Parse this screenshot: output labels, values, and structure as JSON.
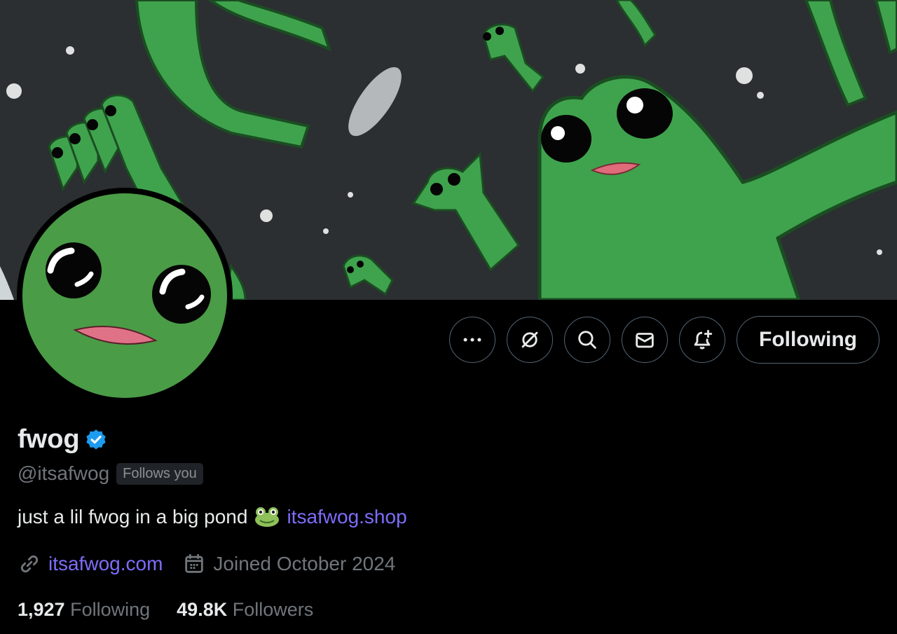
{
  "profile": {
    "display_name": "fwog",
    "handle": "@itsafwog",
    "follows_you_badge": "Follows you",
    "bio_text": "just a lil fwog in a big pond",
    "bio_link": "itsafwog.shop",
    "website": "itsafwog.com",
    "joined": "Joined October 2024",
    "verified": true
  },
  "stats": {
    "following_count": "1,927",
    "following_label": "Following",
    "followers_count": "49.8K",
    "followers_label": "Followers"
  },
  "actions": {
    "more_icon": "ellipsis-icon",
    "grok_icon": "grok-icon",
    "search_icon": "search-icon",
    "message_icon": "envelope-icon",
    "notify_icon": "bell-plus-icon",
    "follow_label": "Following"
  },
  "colors": {
    "background": "#000000",
    "text_primary": "#e7e9ea",
    "text_secondary": "#71767b",
    "link": "#7c6dfa",
    "verified_badge": "#1d9bf0",
    "frog_green": "#3fa34d"
  }
}
